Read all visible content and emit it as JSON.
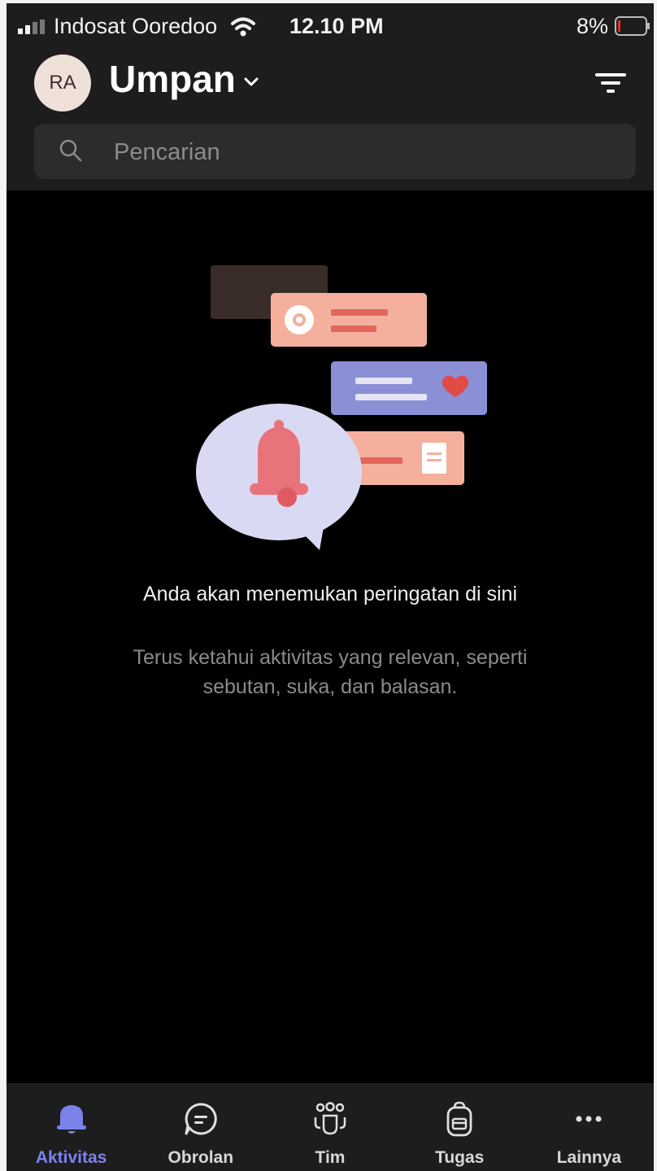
{
  "status_bar": {
    "carrier": "Indosat Ooredoo",
    "time": "12.10 PM",
    "battery": "8%"
  },
  "header": {
    "avatar_initials": "RA",
    "title": "Umpan"
  },
  "search": {
    "placeholder": "Pencarian"
  },
  "empty_state": {
    "title": "Anda akan menemukan peringatan di sini",
    "subtitle": "Terus ketahui aktivitas yang relevan, seperti sebutan, suka, dan balasan."
  },
  "tabs": [
    {
      "label": "Aktivitas",
      "icon": "bell-icon",
      "active": true
    },
    {
      "label": "Obrolan",
      "icon": "chat-icon",
      "active": false
    },
    {
      "label": "Tim",
      "icon": "teams-icon",
      "active": false
    },
    {
      "label": "Tugas",
      "icon": "backpack-icon",
      "active": false
    },
    {
      "label": "Lainnya",
      "icon": "more-icon",
      "active": false
    }
  ],
  "colors": {
    "accent": "#7b83eb",
    "background": "#000000",
    "header": "#1d1d1d",
    "battery_low": "#e0302f"
  }
}
